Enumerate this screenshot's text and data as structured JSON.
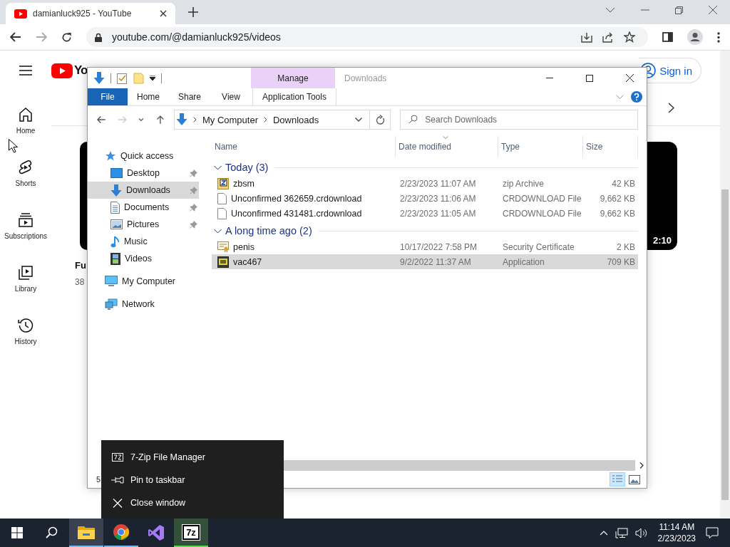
{
  "browser": {
    "tab": {
      "title": "damianluck925 - YouTube"
    },
    "url": "youtube.com/@damianluck925/videos"
  },
  "youtube": {
    "logo": "Yo",
    "sign_in": "Sign in",
    "nav": [
      {
        "label": "Home",
        "kind": "home"
      },
      {
        "label": "Shorts",
        "kind": "shorts"
      },
      {
        "label": "Subscriptions",
        "kind": "subscriptions"
      },
      {
        "label": "Library",
        "kind": "library"
      },
      {
        "label": "History",
        "kind": "history"
      }
    ],
    "videos": [
      {
        "title": "Fu",
        "meta": "38"
      },
      {
        "duration": "2:10"
      }
    ]
  },
  "explorer": {
    "title": "Downloads",
    "contextual_group": "Manage",
    "ribbon_tabs": [
      {
        "label": "File",
        "kind": "file"
      },
      {
        "label": "Home",
        "kind": "tab"
      },
      {
        "label": "Share",
        "kind": "tab"
      },
      {
        "label": "View",
        "kind": "tab"
      },
      {
        "label": "Application Tools",
        "kind": "contextual"
      }
    ],
    "nav_buttons": [
      {
        "kind": "back",
        "disabled": false
      },
      {
        "kind": "forward",
        "disabled": true
      },
      {
        "kind": "recent",
        "disabled": false
      },
      {
        "kind": "up",
        "disabled": false
      }
    ],
    "breadcrumb": [
      "My Computer",
      "Downloads"
    ],
    "search": {
      "placeholder": "Search Downloads"
    },
    "nav": [
      {
        "label": "Quick access",
        "kind": "quick",
        "selected": false,
        "children": [
          {
            "label": "Desktop",
            "kind": "desktop",
            "pinned": true,
            "selected": false
          },
          {
            "label": "Downloads",
            "kind": "downloads",
            "pinned": true,
            "selected": true
          },
          {
            "label": "Documents",
            "kind": "documents",
            "pinned": true,
            "selected": false
          },
          {
            "label": "Pictures",
            "kind": "pictures",
            "pinned": true,
            "selected": false
          },
          {
            "label": "Music",
            "kind": "music",
            "pinned": false,
            "selected": false
          },
          {
            "label": "Videos",
            "kind": "videos",
            "pinned": false,
            "selected": false
          }
        ]
      },
      {
        "label": "My Computer",
        "kind": "computer",
        "selected": false
      },
      {
        "label": "Network",
        "kind": "network",
        "selected": false
      }
    ],
    "columns": [
      "Name",
      "Date modified",
      "Type",
      "Size"
    ],
    "groups": [
      {
        "label": "Today (3)",
        "expanded": true,
        "files": [
          {
            "name": "zbsm",
            "date": "2/23/2023 11:07 AM",
            "type": "zip Archive",
            "size": "42 KB",
            "kind": "zip",
            "selected": false
          },
          {
            "name": "Unconfirmed 362659.crdownload",
            "date": "2/23/2023 11:06 AM",
            "type": "CRDOWNLOAD File",
            "size": "9,662 KB",
            "kind": "file",
            "selected": false
          },
          {
            "name": "Unconfirmed 431481.crdownload",
            "date": "2/23/2023 11:05 AM",
            "type": "CRDOWNLOAD File",
            "size": "9,662 KB",
            "kind": "file",
            "selected": false
          }
        ]
      },
      {
        "label": "A long time ago (2)",
        "expanded": true,
        "files": [
          {
            "name": "penis",
            "date": "10/17/2022 7:58 PM",
            "type": "Security Certificate",
            "size": "2 KB",
            "kind": "cert",
            "selected": false
          },
          {
            "name": "vac467",
            "date": "9/2/2022 11:37 AM",
            "type": "Application",
            "size": "709 KB",
            "kind": "app",
            "selected": true
          }
        ]
      }
    ],
    "status": "5"
  },
  "context_menu": [
    {
      "label": "7-Zip File Manager",
      "kind": "app"
    },
    {
      "label": "Pin to taskbar",
      "kind": "pin"
    },
    {
      "label": "Close window",
      "kind": "close"
    }
  ],
  "taskbar": {
    "apps": [
      {
        "kind": "explorer",
        "active": true,
        "running": true
      },
      {
        "kind": "chrome",
        "active": false,
        "running": true
      },
      {
        "kind": "vs",
        "active": false,
        "running": false
      },
      {
        "kind": "sevenzip",
        "label": "7z",
        "active": true,
        "running": true
      }
    ],
    "time": "11:14 AM",
    "date": "2/23/2023"
  }
}
